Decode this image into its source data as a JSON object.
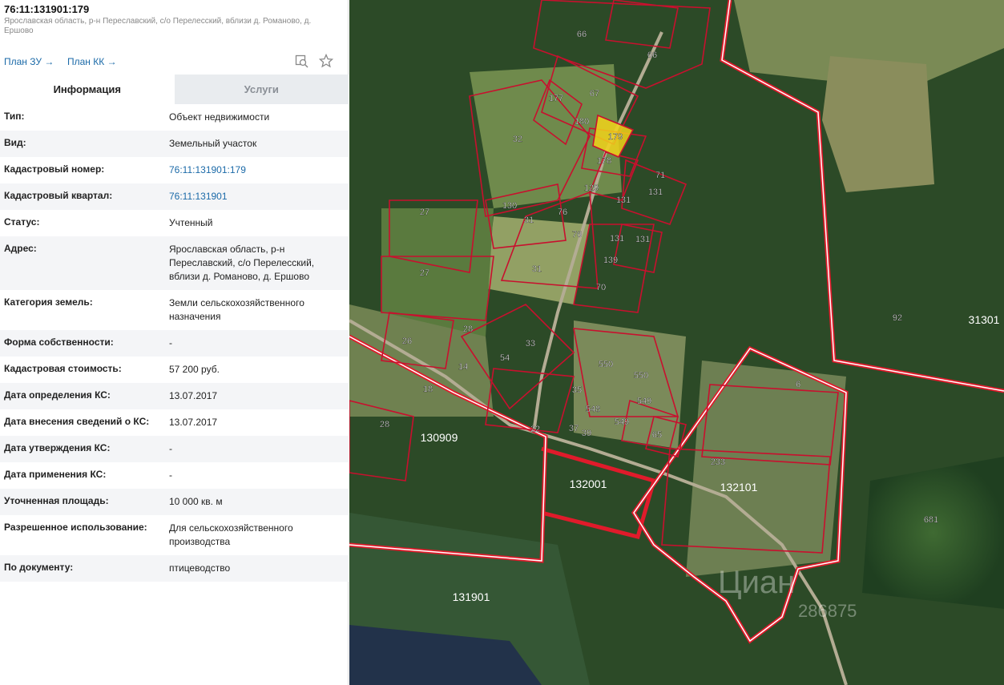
{
  "header": {
    "title": "76:11:131901:179",
    "address": "Ярославская область, р-н Переславский, с/о Перелесский, вблизи д. Романово, д. Ершово",
    "plan_zu": "План ЗУ →",
    "plan_kk": "План КК →"
  },
  "tabs": [
    {
      "label": "Информация",
      "active": true
    },
    {
      "label": "Услуги",
      "active": false
    }
  ],
  "info_rows": [
    {
      "key": "Тип:",
      "value": "Объект недвижимости"
    },
    {
      "key": "Вид:",
      "value": "Земельный участок"
    },
    {
      "key": "Кадастровый номер:",
      "value": "76:11:131901:179"
    },
    {
      "key": "Кадастровый квартал:",
      "value": "76:11:131901"
    },
    {
      "key": "Статус:",
      "value": "Учтенный"
    },
    {
      "key": "Адрес:",
      "value": "Ярославская область, р-н Переславский, с/о Перелесский, вблизи д. Романово, д. Ершово"
    },
    {
      "key": "Категория земель:",
      "value": "Земли сельскохозяйственного назначения"
    },
    {
      "key": "Форма собственности:",
      "value": "-"
    },
    {
      "key": "Кадастровая стоимость:",
      "value": "57 200 руб."
    },
    {
      "key": "Дата определения КС:",
      "value": "13.07.2017"
    },
    {
      "key": "Дата внесения сведений о КС:",
      "value": "13.07.2017"
    },
    {
      "key": "Дата утверждения КС:",
      "value": "-"
    },
    {
      "key": "Дата применения КС:",
      "value": "-"
    },
    {
      "key": "Уточненная площадь:",
      "value": "10 000 кв. м"
    },
    {
      "key": "Разрешенное использование:",
      "value": "Для сельскохозяйственного производства"
    },
    {
      "key": "По документу:",
      "value": "птицеводство"
    }
  ],
  "icons": [
    "search-map-icon",
    "star-icon"
  ],
  "map": {
    "parcel_labels": [
      "66",
      "66",
      "67",
      "177",
      "180",
      "179",
      "32",
      "178",
      "71",
      "131",
      "129",
      "131",
      "130",
      "31",
      "76",
      "27",
      "76",
      "131",
      "131",
      "139",
      "31",
      "27",
      "70",
      "28",
      "26",
      "33",
      "54",
      "550",
      "550",
      "14",
      "35",
      "549",
      "548",
      "549",
      "18",
      "37",
      "39",
      "22",
      "65",
      "6",
      "28",
      "233",
      "92",
      "681"
    ],
    "quarter_labels": [
      "130909",
      "132001",
      "132101",
      "131901",
      "31301"
    ],
    "watermark": "Циан",
    "watermark_number": "286875"
  },
  "colors": {
    "link": "#1b6aa8",
    "parcel_border": "#c8102e",
    "selected_parcel": "#f2d21a",
    "quarter_border": "#e01b2b"
  }
}
